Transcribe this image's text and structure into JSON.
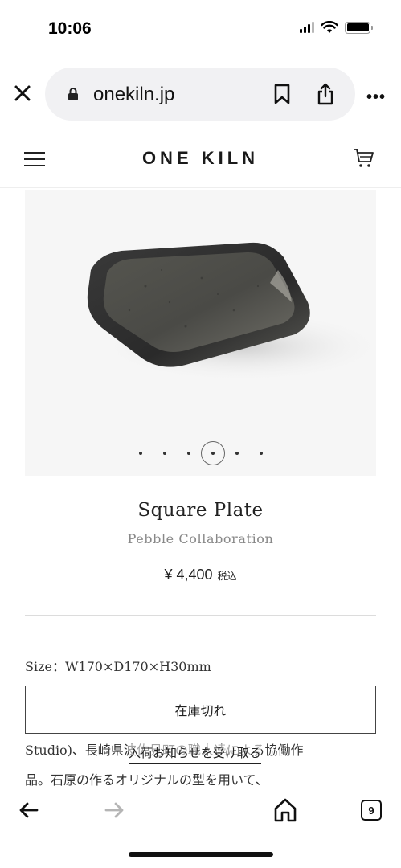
{
  "status_bar": {
    "time": "10:06"
  },
  "browser": {
    "url": "onekiln.jp",
    "more_label": "•••"
  },
  "site": {
    "logo": "ONE KILN"
  },
  "product": {
    "title": "Square Plate",
    "subtitle": "Pebble Collaboration",
    "price": "¥ 4,400",
    "tax_label": "税込",
    "size": "Size：W170×D170×H30mm",
    "stock_button": "在庫切れ",
    "restock_link": "入荷お知らせを受け取る",
    "description_line1": "Studio)、長崎県波佐見町の職人達による協働作",
    "description_line2": "品。石原の作るオリジナルの型を用いて、"
  },
  "carousel": {
    "slide_count": 6,
    "active_index": 3
  },
  "toolbar": {
    "tab_count": "9"
  }
}
